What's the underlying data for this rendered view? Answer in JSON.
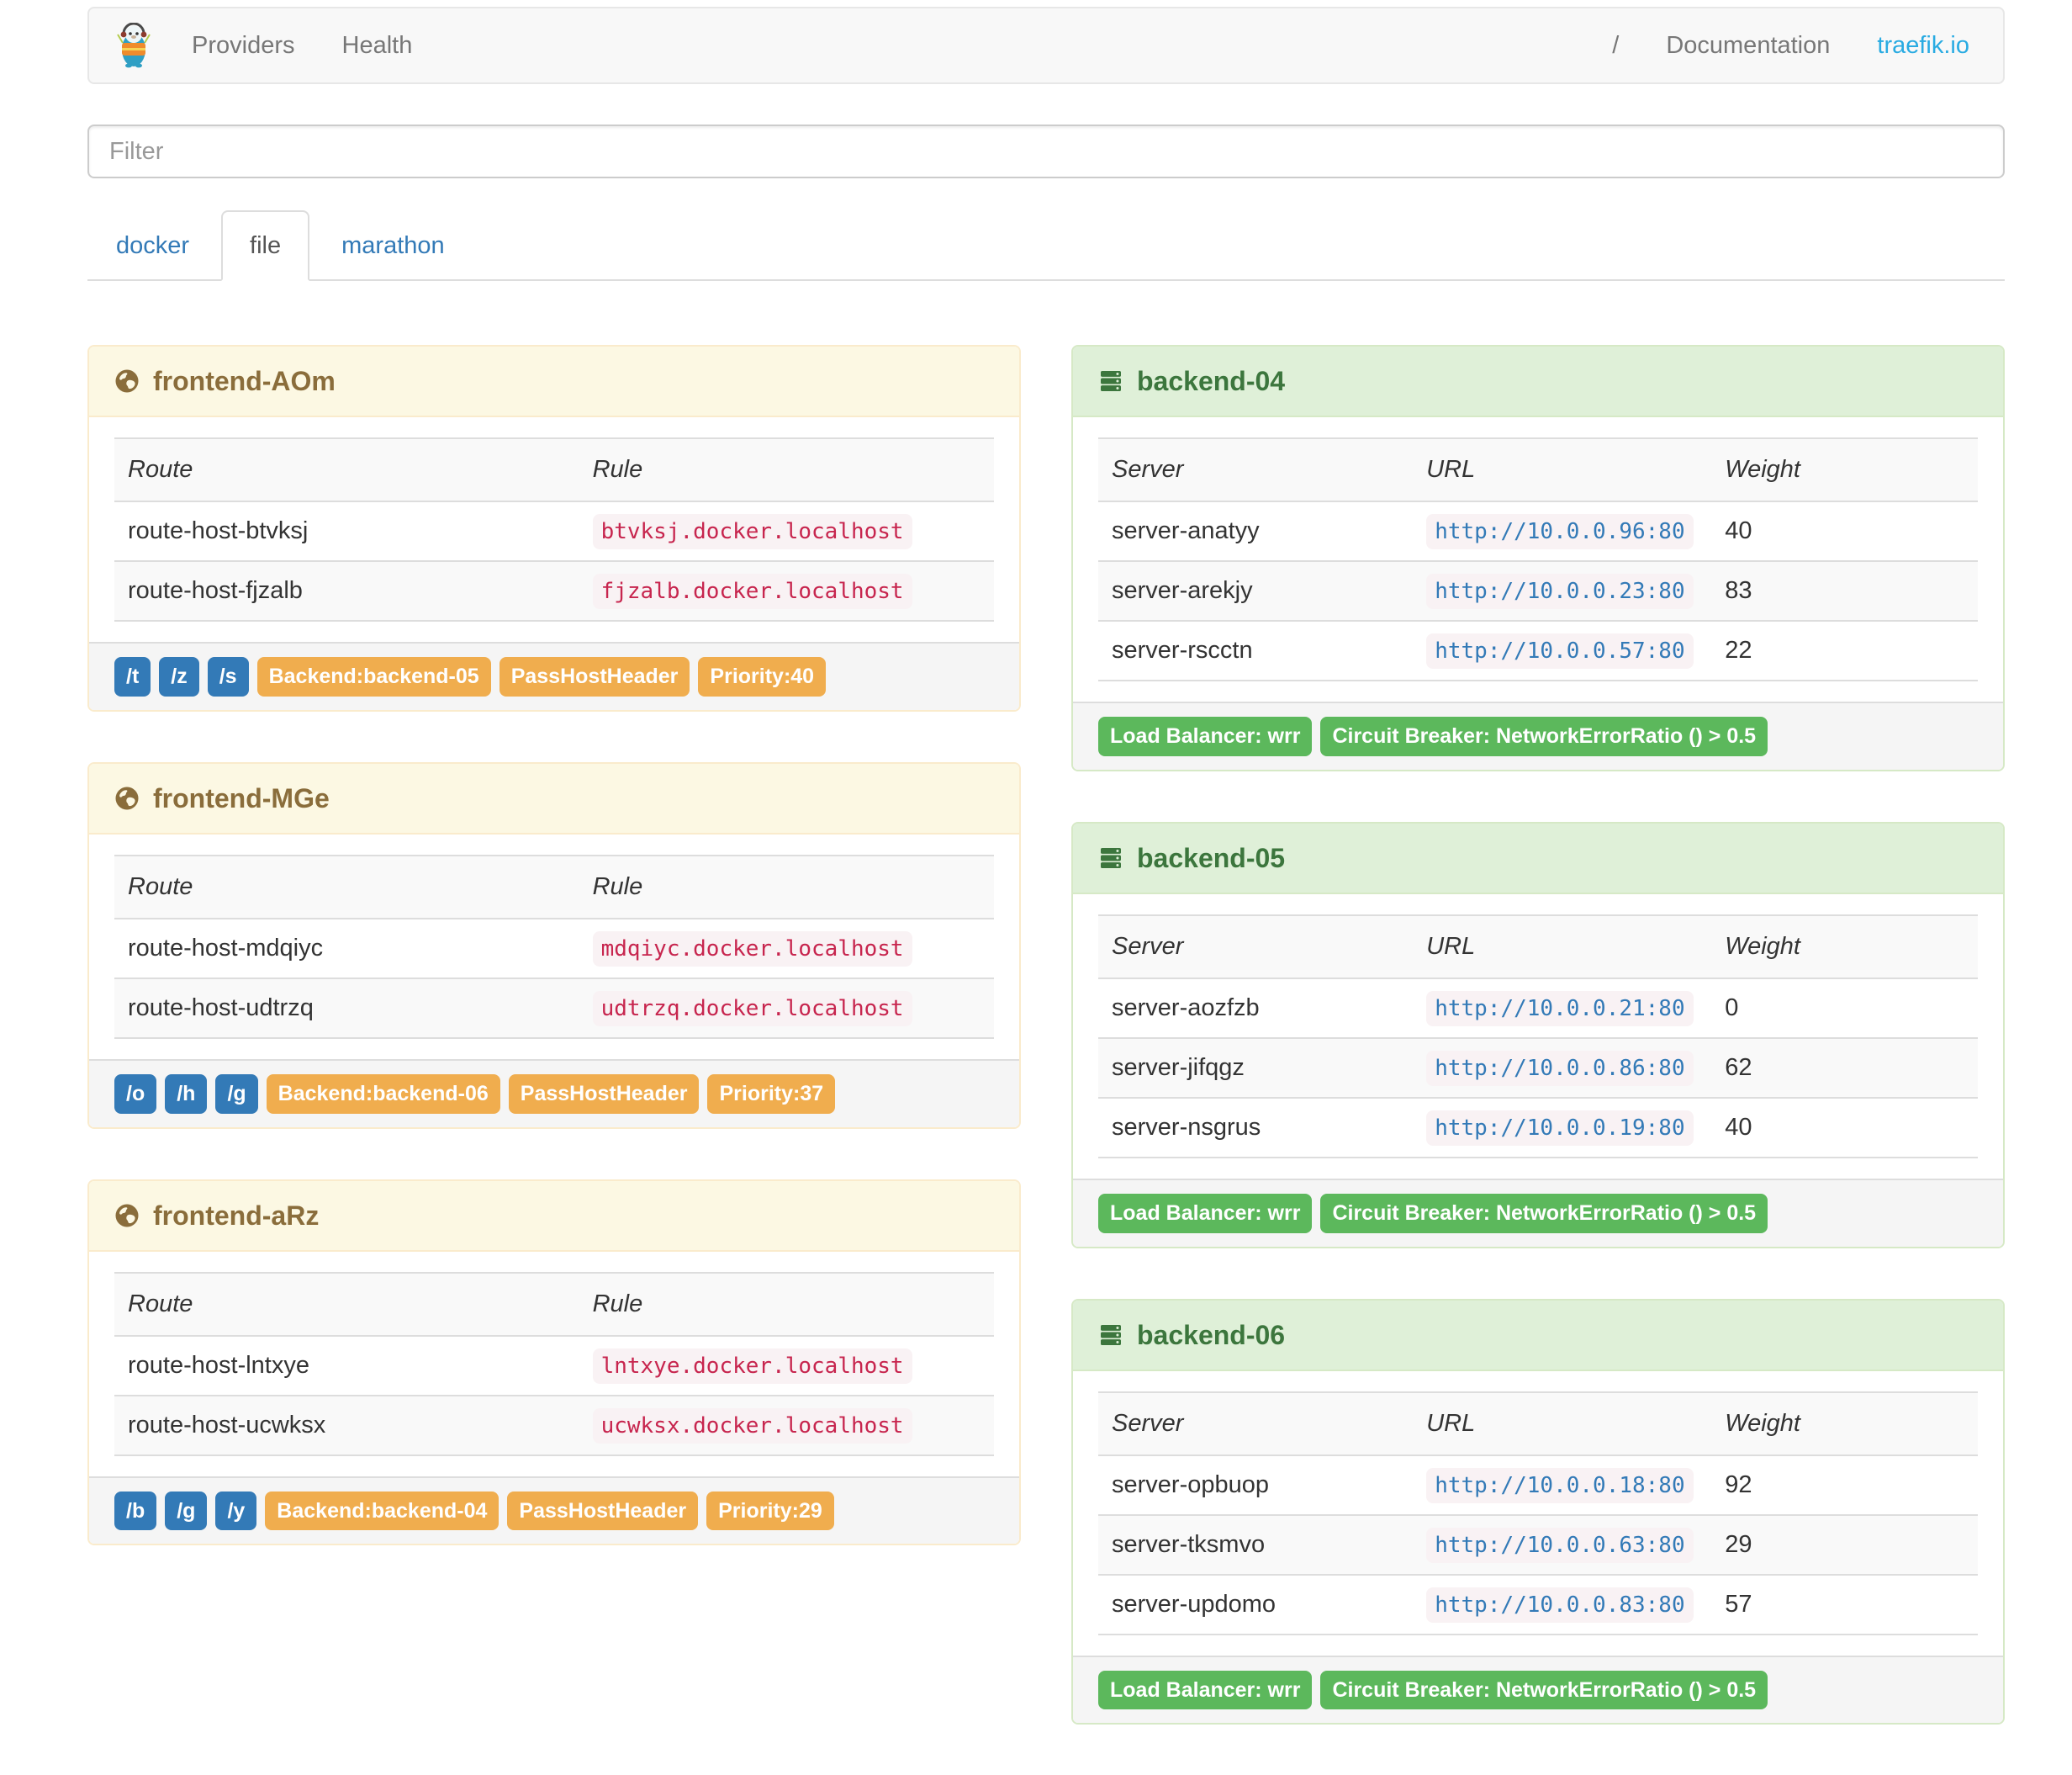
{
  "navbar": {
    "logo": "traefik-gopher-logo",
    "left_links": [
      "Providers",
      "Health"
    ],
    "right_links": [
      "/",
      "Documentation",
      "traefik.io"
    ]
  },
  "filter": {
    "placeholder": "Filter"
  },
  "tabs": [
    {
      "label": "docker",
      "active": false
    },
    {
      "label": "file",
      "active": true
    },
    {
      "label": "marathon",
      "active": false
    }
  ],
  "frontends": [
    {
      "title": "frontend-AOm",
      "columns": [
        "Route",
        "Rule"
      ],
      "routes": [
        {
          "route": "route-host-btvksj",
          "rule": "btvksj.docker.localhost"
        },
        {
          "route": "route-host-fjzalb",
          "rule": "fjzalb.docker.localhost"
        }
      ],
      "route_badges": [
        "/t",
        "/z",
        "/s"
      ],
      "prop_badges": [
        "Backend:backend-05",
        "PassHostHeader",
        "Priority:40"
      ]
    },
    {
      "title": "frontend-MGe",
      "columns": [
        "Route",
        "Rule"
      ],
      "routes": [
        {
          "route": "route-host-mdqiyc",
          "rule": "mdqiyc.docker.localhost"
        },
        {
          "route": "route-host-udtrzq",
          "rule": "udtrzq.docker.localhost"
        }
      ],
      "route_badges": [
        "/o",
        "/h",
        "/g"
      ],
      "prop_badges": [
        "Backend:backend-06",
        "PassHostHeader",
        "Priority:37"
      ]
    },
    {
      "title": "frontend-aRz",
      "columns": [
        "Route",
        "Rule"
      ],
      "routes": [
        {
          "route": "route-host-lntxye",
          "rule": "lntxye.docker.localhost"
        },
        {
          "route": "route-host-ucwksx",
          "rule": "ucwksx.docker.localhost"
        }
      ],
      "route_badges": [
        "/b",
        "/g",
        "/y"
      ],
      "prop_badges": [
        "Backend:backend-04",
        "PassHostHeader",
        "Priority:29"
      ]
    }
  ],
  "backends": [
    {
      "title": "backend-04",
      "columns": [
        "Server",
        "URL",
        "Weight"
      ],
      "servers": [
        {
          "server": "server-anatyy",
          "url": "http://10.0.0.96:80",
          "weight": "40"
        },
        {
          "server": "server-arekjy",
          "url": "http://10.0.0.23:80",
          "weight": "83"
        },
        {
          "server": "server-rscctn",
          "url": "http://10.0.0.57:80",
          "weight": "22"
        }
      ],
      "badges": [
        "Load Balancer: wrr",
        "Circuit Breaker: NetworkErrorRatio () > 0.5"
      ]
    },
    {
      "title": "backend-05",
      "columns": [
        "Server",
        "URL",
        "Weight"
      ],
      "servers": [
        {
          "server": "server-aozfzb",
          "url": "http://10.0.0.21:80",
          "weight": "0"
        },
        {
          "server": "server-jifqgz",
          "url": "http://10.0.0.86:80",
          "weight": "62"
        },
        {
          "server": "server-nsgrus",
          "url": "http://10.0.0.19:80",
          "weight": "40"
        }
      ],
      "badges": [
        "Load Balancer: wrr",
        "Circuit Breaker: NetworkErrorRatio () > 0.5"
      ]
    },
    {
      "title": "backend-06",
      "columns": [
        "Server",
        "URL",
        "Weight"
      ],
      "servers": [
        {
          "server": "server-opbuop",
          "url": "http://10.0.0.18:80",
          "weight": "92"
        },
        {
          "server": "server-tksmvo",
          "url": "http://10.0.0.63:80",
          "weight": "29"
        },
        {
          "server": "server-updomo",
          "url": "http://10.0.0.83:80",
          "weight": "57"
        }
      ],
      "badges": [
        "Load Balancer: wrr",
        "Circuit Breaker: NetworkErrorRatio () > 0.5"
      ]
    }
  ],
  "colors": {
    "frontend_header_bg": "#fcf8e3",
    "frontend_header_text": "#8a6d3b",
    "frontend_border": "#faebcc",
    "backend_header_bg": "#dff0d8",
    "backend_header_text": "#3c763d",
    "backend_border": "#d6e9c6",
    "badge_blue": "#337ab7",
    "badge_orange": "#f0ad4e",
    "badge_green": "#5cb85c",
    "code_text": "#c7254e",
    "code_bg": "#f9f2f4",
    "link_blue": "#337ab7",
    "brand_blue": "#29abe2",
    "navbar_bg": "#f8f8f8",
    "nav_text": "#777777"
  }
}
